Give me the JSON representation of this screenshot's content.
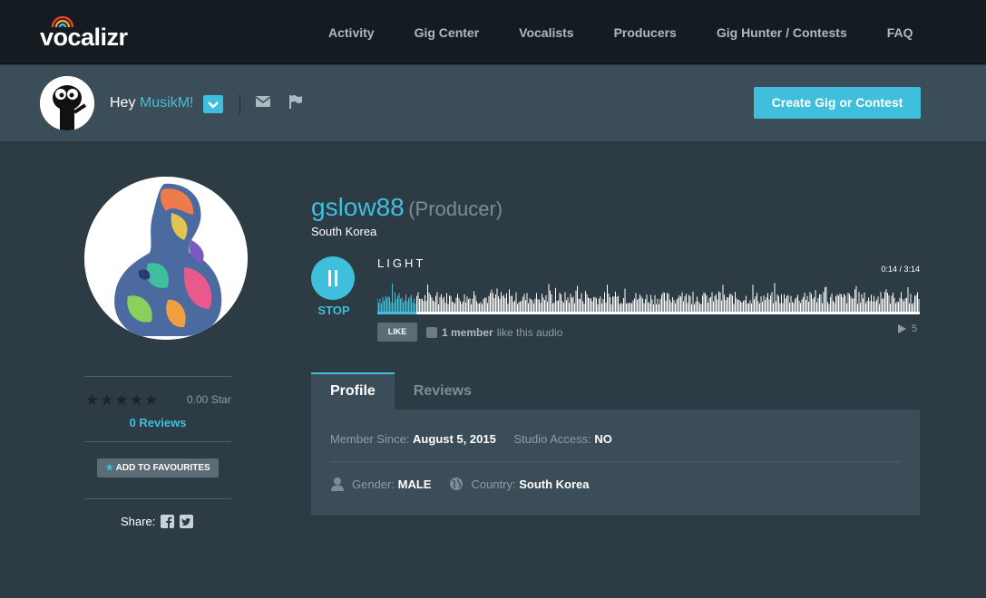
{
  "brand": {
    "logo_text": "vocalizr",
    "arc_colors": [
      "#e8412c",
      "#f4a225",
      "#3fbfdc"
    ]
  },
  "nav": {
    "items": [
      "Activity",
      "Gig Center",
      "Vocalists",
      "Producers",
      "Gig Hunter / Contests",
      "FAQ"
    ]
  },
  "userbar": {
    "greeting": "Hey",
    "username": "MusikM!",
    "create_button": "Create Gig or Contest"
  },
  "profile": {
    "username": "gslow88",
    "role": "(Producer)",
    "country": "South Korea",
    "rating_score": "0.00 Star",
    "rating_stars": 0,
    "reviews_link": "0 Reviews",
    "favourites_button": "ADD TO FAVOURITES",
    "share_label": "Share:"
  },
  "player": {
    "state": "playing",
    "stop_label": "STOP",
    "track_title": "LIGHT",
    "time": "0:14 / 3:14",
    "progress": 0.072,
    "like_button": "LIKE",
    "like_count": "1 member",
    "like_suffix": "like this audio",
    "play_count": "5"
  },
  "tabs": [
    {
      "label": "Profile",
      "active": true
    },
    {
      "label": "Reviews",
      "active": false
    }
  ],
  "details": {
    "member_since_label": "Member Since:",
    "member_since": "August 5, 2015",
    "studio_access_label": "Studio Access:",
    "studio_access": "NO",
    "gender_label": "Gender:",
    "gender": "MALE",
    "country_label": "Country:",
    "country": "South Korea"
  },
  "colors": {
    "accent": "#3fbfdc",
    "background": "#2d3b45",
    "nav_bg": "#141c22",
    "panel": "#3b4d58"
  }
}
